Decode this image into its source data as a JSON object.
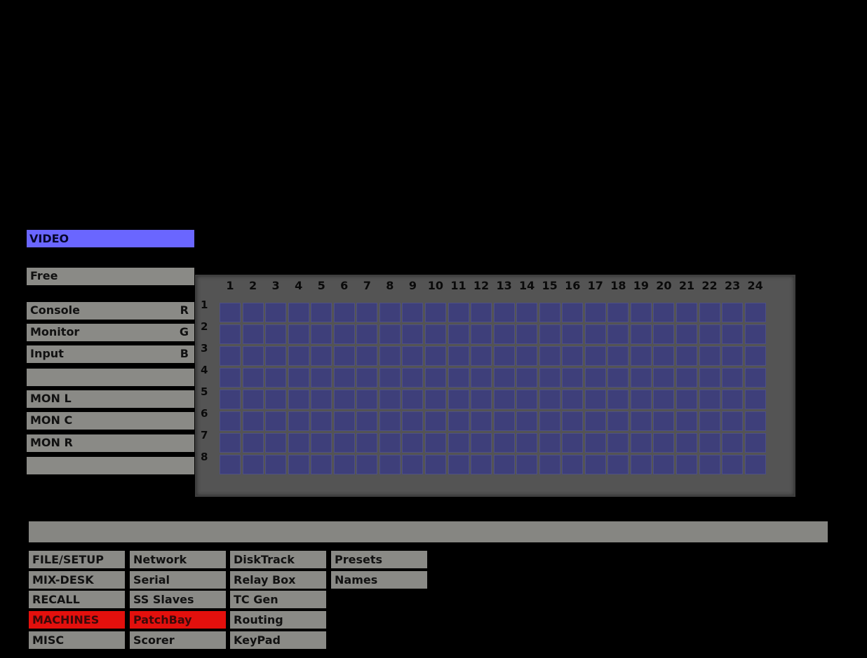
{
  "section_title": "VIDEO",
  "left_panel": {
    "free": "Free",
    "rows": [
      {
        "label": "Console",
        "key": "R"
      },
      {
        "label": "Monitor",
        "key": "G"
      },
      {
        "label": "Input",
        "key": "B"
      },
      {
        "label": "",
        "key": ""
      },
      {
        "label": "MON  L",
        "key": ""
      },
      {
        "label": "MON  C",
        "key": ""
      },
      {
        "label": "MON  R",
        "key": ""
      },
      {
        "label": "",
        "key": ""
      }
    ]
  },
  "patch_grid": {
    "columns": [
      "1",
      "2",
      "3",
      "4",
      "5",
      "6",
      "7",
      "8",
      "9",
      "10",
      "11",
      "12",
      "13",
      "14",
      "15",
      "16",
      "17",
      "18",
      "19",
      "20",
      "21",
      "22",
      "23",
      "24"
    ],
    "rows": [
      "1",
      "2",
      "3",
      "4",
      "5",
      "6",
      "7",
      "8"
    ]
  },
  "status_text": "",
  "menu": {
    "col1": [
      {
        "label": "FILE/SETUP",
        "active": false
      },
      {
        "label": "MIX-DESK",
        "active": false
      },
      {
        "label": "RECALL",
        "active": false
      },
      {
        "label": "MACHINES",
        "active": true
      },
      {
        "label": "MISC",
        "active": false
      }
    ],
    "col2": [
      {
        "label": "Network",
        "active": false
      },
      {
        "label": "Serial",
        "active": false
      },
      {
        "label": "SS  Slaves",
        "active": false
      },
      {
        "label": "PatchBay",
        "active": true
      },
      {
        "label": "Scorer",
        "active": false
      }
    ],
    "col3": [
      {
        "label": "DiskTrack",
        "active": false
      },
      {
        "label": "Relay  Box",
        "active": false
      },
      {
        "label": "TC  Gen",
        "active": false
      },
      {
        "label": "Routing",
        "active": false
      },
      {
        "label": "KeyPad",
        "active": false
      }
    ],
    "col4": [
      {
        "label": "Presets",
        "active": false
      },
      {
        "label": "Names",
        "active": false
      }
    ]
  },
  "colors": {
    "title_bg": "#6a66ff",
    "cell_bg": "#3e3f7a",
    "active_bg": "#e3100d",
    "button_bg": "#8a8a86"
  }
}
